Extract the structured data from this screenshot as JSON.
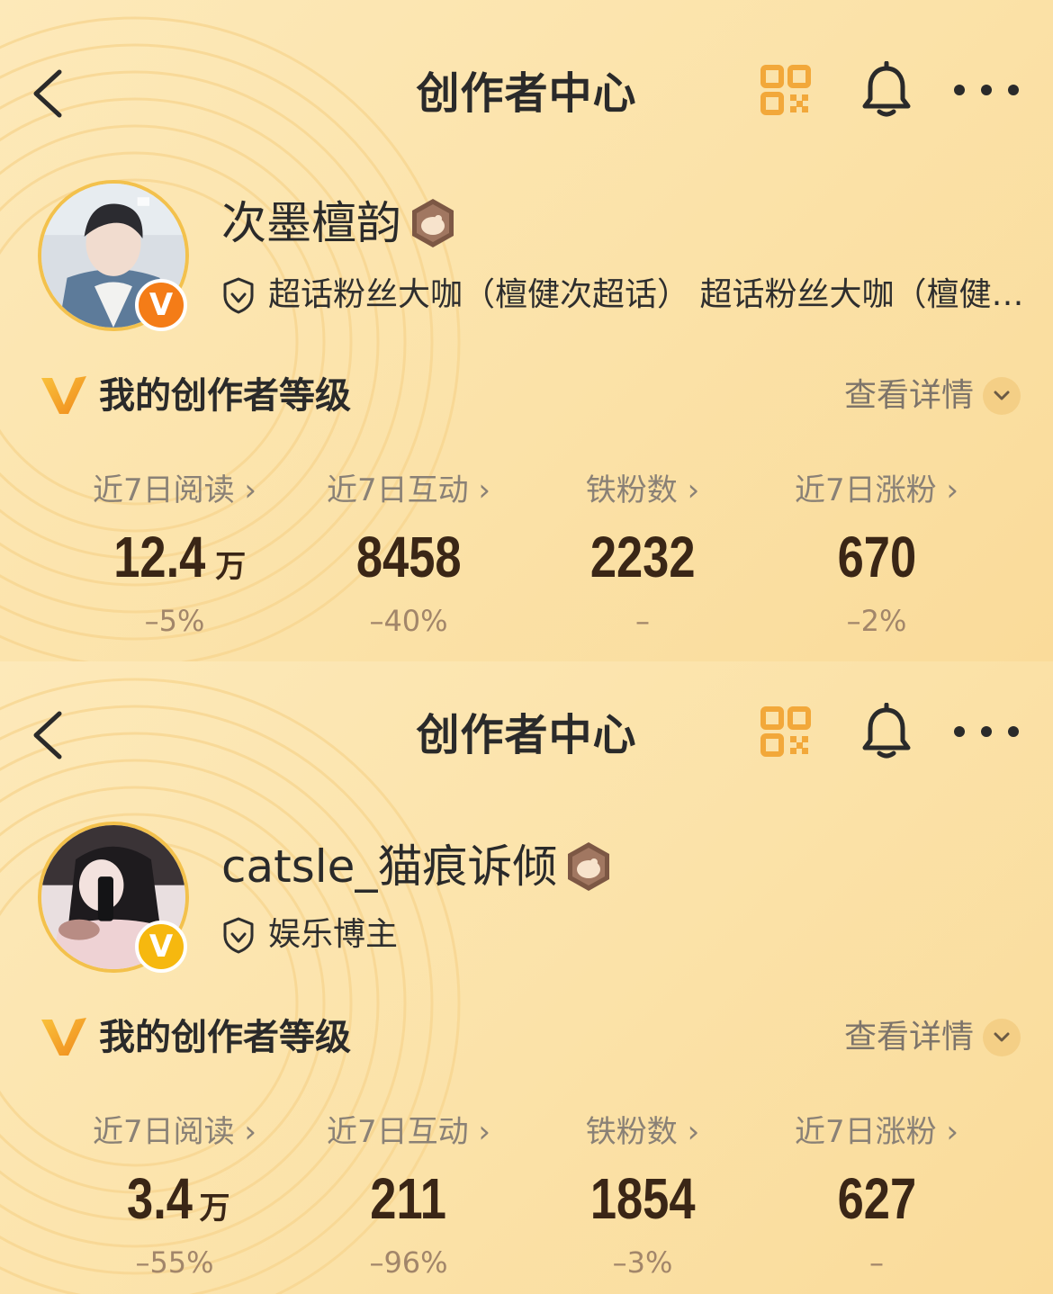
{
  "panels": [
    {
      "header": {
        "title": "创作者中心",
        "back_icon": "chevron-left-icon",
        "qr_icon": "qr-code-icon",
        "bell_icon": "bell-icon",
        "more_icon": "more-icon"
      },
      "profile": {
        "name": "次墨檀韵",
        "verified_badge": "V",
        "badge_color": "#f47c17",
        "tag": "超话粉丝大咖（檀健次超话） 超话粉丝大咖（檀健次超话）"
      },
      "level": {
        "title": "我的创作者等级",
        "details_label": "查看详情"
      },
      "stats": [
        {
          "label": "近7日阅读 ›",
          "value": "12.4",
          "unit": "万",
          "change": "–5%"
        },
        {
          "label": "近7日互动 ›",
          "value": "8458",
          "unit": "",
          "change": "–40%"
        },
        {
          "label": "铁粉数 ›",
          "value": "2232",
          "unit": "",
          "change": "–"
        },
        {
          "label": "近7日涨粉 ›",
          "value": "670",
          "unit": "",
          "change": "–2%"
        }
      ]
    },
    {
      "header": {
        "title": "创作者中心",
        "back_icon": "chevron-left-icon",
        "qr_icon": "qr-code-icon",
        "bell_icon": "bell-icon",
        "more_icon": "more-icon"
      },
      "profile": {
        "name": "catsle_猫痕诉倾",
        "verified_badge": "V",
        "badge_color": "#f6b80f",
        "tag": "娱乐博主"
      },
      "level": {
        "title": "我的创作者等级",
        "details_label": "查看详情"
      },
      "stats": [
        {
          "label": "近7日阅读 ›",
          "value": "3.4",
          "unit": "万",
          "change": "–55%"
        },
        {
          "label": "近7日互动 ›",
          "value": "211",
          "unit": "",
          "change": "–96%"
        },
        {
          "label": "铁粉数 ›",
          "value": "1854",
          "unit": "",
          "change": "–3%"
        },
        {
          "label": "近7日涨粉 ›",
          "value": "627",
          "unit": "",
          "change": "–"
        }
      ]
    }
  ],
  "colors": {
    "accent": "#f3a93a",
    "text_primary": "#2a2a2a",
    "stat_value": "#3a2616"
  }
}
